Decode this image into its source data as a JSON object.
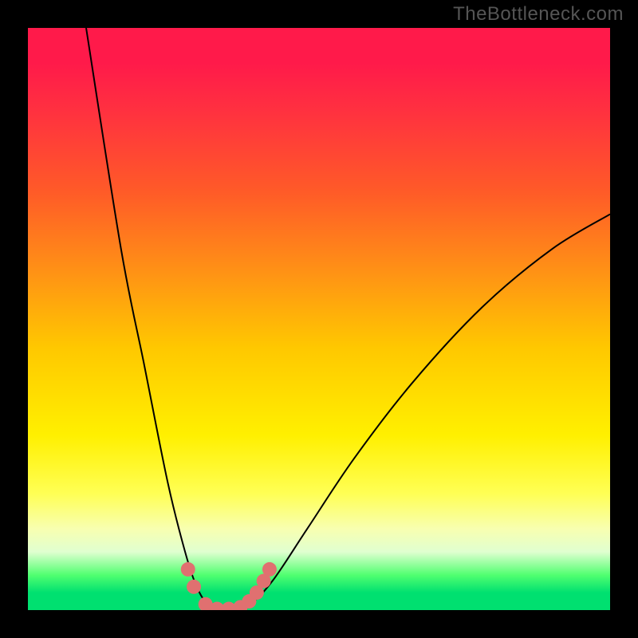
{
  "watermark": "TheBottleneck.com",
  "chart_data": {
    "type": "line",
    "title": "",
    "xlabel": "",
    "ylabel": "",
    "xlim": [
      0,
      100
    ],
    "ylim": [
      0,
      100
    ],
    "left_branch": [
      {
        "x": 10,
        "y": 100
      },
      {
        "x": 16,
        "y": 62
      },
      {
        "x": 20,
        "y": 42
      },
      {
        "x": 24,
        "y": 22
      },
      {
        "x": 27,
        "y": 10
      },
      {
        "x": 29,
        "y": 4
      },
      {
        "x": 31,
        "y": 1
      },
      {
        "x": 34,
        "y": 0
      }
    ],
    "right_branch": [
      {
        "x": 34,
        "y": 0
      },
      {
        "x": 38,
        "y": 1
      },
      {
        "x": 42,
        "y": 5
      },
      {
        "x": 48,
        "y": 14
      },
      {
        "x": 56,
        "y": 26
      },
      {
        "x": 66,
        "y": 39
      },
      {
        "x": 78,
        "y": 52
      },
      {
        "x": 90,
        "y": 62
      },
      {
        "x": 100,
        "y": 68
      }
    ],
    "markers": [
      {
        "x": 27.5,
        "y": 7
      },
      {
        "x": 28.5,
        "y": 4
      },
      {
        "x": 30.5,
        "y": 1
      },
      {
        "x": 32.5,
        "y": 0.2
      },
      {
        "x": 34.5,
        "y": 0.2
      },
      {
        "x": 36.5,
        "y": 0.5
      },
      {
        "x": 38,
        "y": 1.5
      },
      {
        "x": 39.3,
        "y": 3
      },
      {
        "x": 40.5,
        "y": 5
      },
      {
        "x": 41.5,
        "y": 7
      }
    ],
    "gradient_colors": {
      "top": "#ff1a4a",
      "mid_upper": "#ff8a18",
      "mid": "#fff000",
      "mid_lower": "#ffff88",
      "bottom": "#00e070"
    }
  }
}
